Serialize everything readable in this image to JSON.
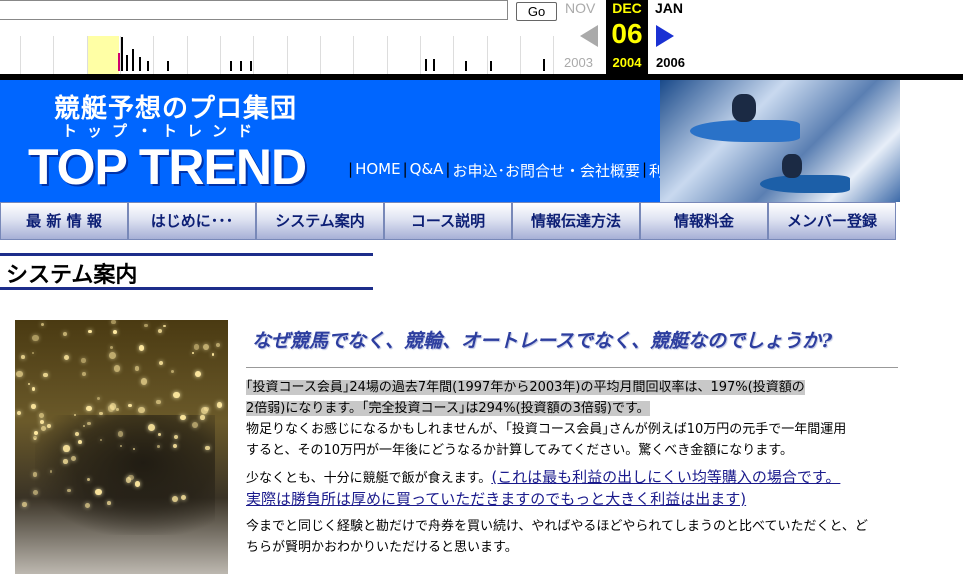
{
  "wayback": {
    "go_label": "Go",
    "prev_month": "NOV",
    "prev_year": "2003",
    "current_month": "DEC",
    "current_day": "06",
    "current_year": "2004",
    "next_month": "JAN",
    "next_year": "2006"
  },
  "banner": {
    "title_jp": "競艇予想のプロ集団",
    "title_kana": "トップ・トレンド",
    "title_en": "TOP TREND",
    "nav": [
      "HOME",
      "Q&A",
      "お申込･お問合せ・会社概要",
      "利用規約"
    ],
    "nav_separator": "|"
  },
  "menu": [
    "最 新 情 報",
    "はじめに･･･",
    "システム案内",
    "コース説明",
    "情報伝達方法",
    "情報料金",
    "メンバー登録"
  ],
  "section_title": "システム案内",
  "main": {
    "headline": "なぜ競馬でなく、競輪、オートレースでなく、競艇なのでしょうか?",
    "p1_line1": "｢投資コース会員｣24場の過去7年間(1997年から2003年)の平均月間回収率は、197%(投資額の",
    "p1_line2": "2倍弱)になります。｢完全投資コース｣は294%(投資額の3倍弱)です。",
    "p2_line1": "物足りなくお感じになるかもしれませんが、｢投資コース会員｣さんが例えば10万円の元手で一年間運用",
    "p2_line2": "すると、その10万円が一年後にどうなるか計算してみてください。驚くべき金額になります。",
    "p3_lead": "少なくとも、十分に競艇で飯が食えます。",
    "p3_link1": "(これは最も利益の出しにくい均等購入の場合です。",
    "p3_link2": "実際は勝負所は厚めに買っていただきますのでもっと大きく利益は出ます)",
    "p4_line1": "今までと同じく経験と勘だけで舟券を買い続け、やればやるほどやられてしまうのと比べていただくと、ど",
    "p4_line2": "ちらが賢明かおわかりいただけると思います。"
  },
  "colors": {
    "banner_blue": "#0066ff",
    "menu_text": "#0d1f75",
    "headline": "#2d3e9f",
    "section_rule": "#1d2d8a",
    "highlight": "#c8c8c8",
    "wayback_current": "#ffff00"
  }
}
